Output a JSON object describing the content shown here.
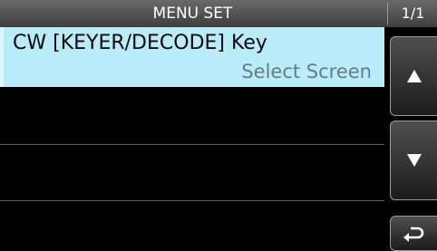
{
  "header": {
    "title": "MENU SET",
    "page": "1/1"
  },
  "menu": {
    "items": [
      {
        "label": "CW [KEYER/DECODE] Key",
        "value": "Select Screen",
        "selected": true
      }
    ]
  },
  "side_buttons": {
    "up": "up-arrow",
    "down": "down-arrow",
    "back": "return-arrow"
  },
  "colors": {
    "selected_row": "#b8ecf8",
    "background": "#000000",
    "title_bar": "#555555"
  }
}
